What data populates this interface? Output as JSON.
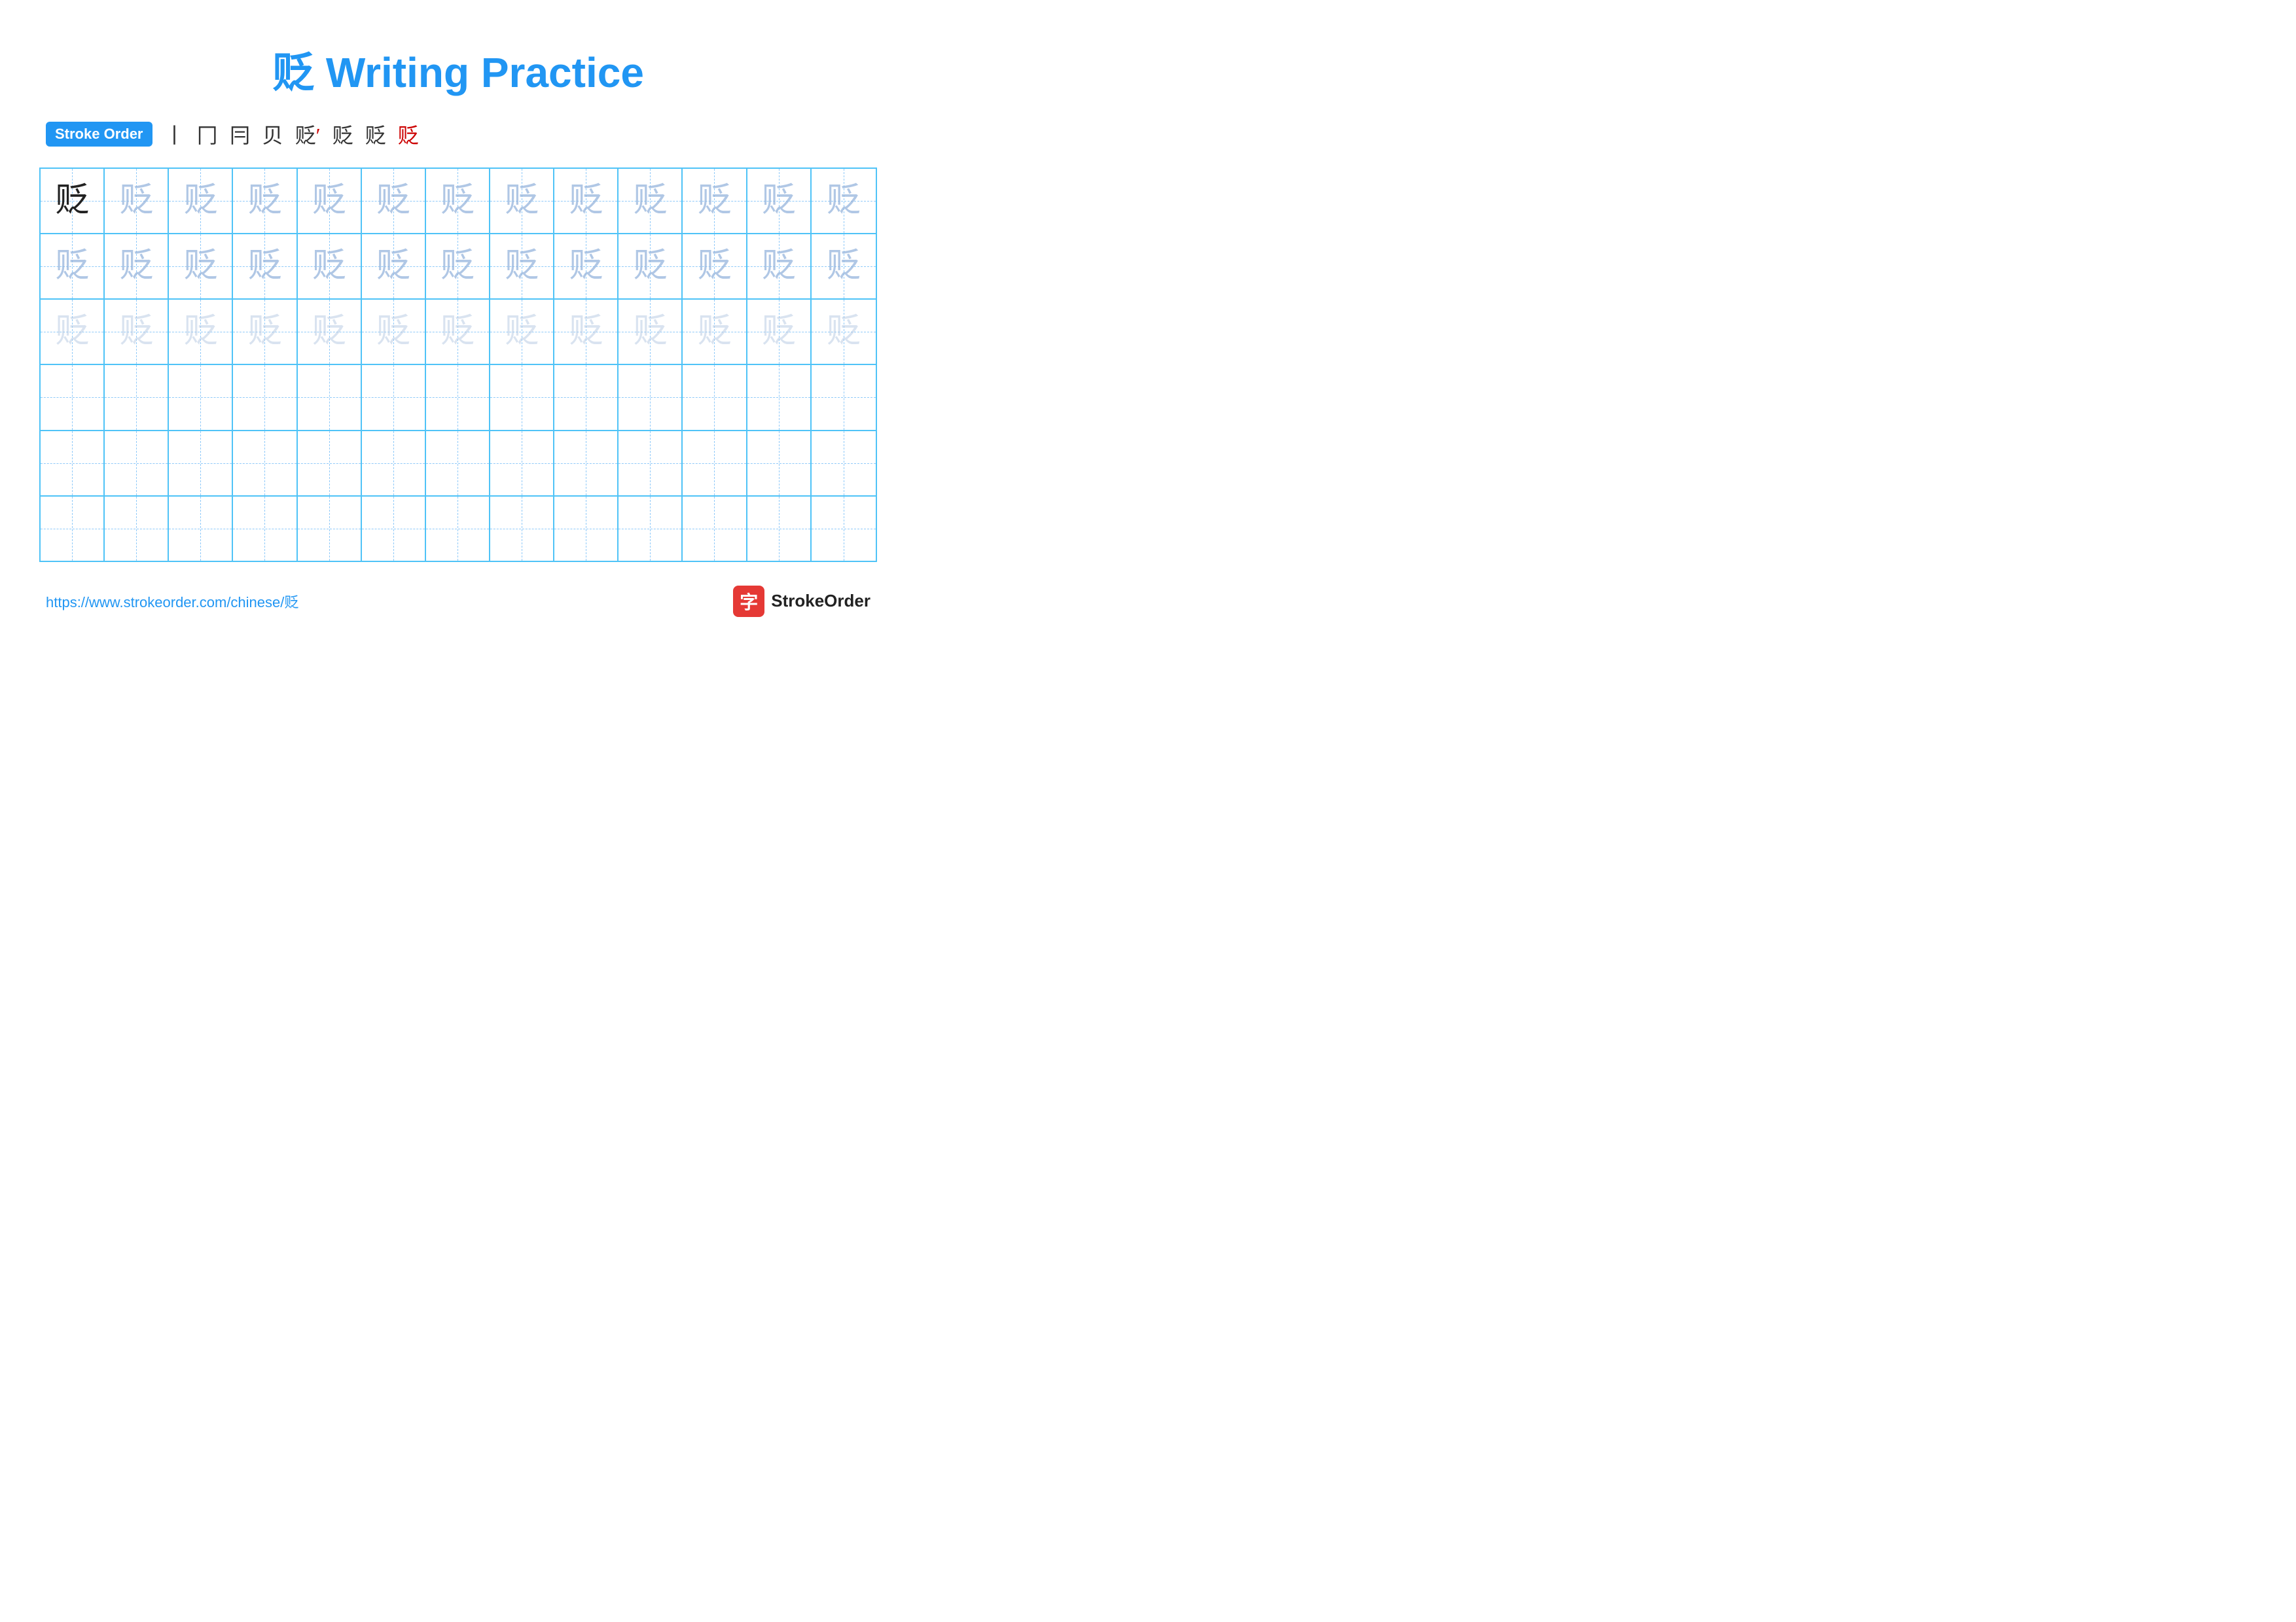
{
  "title": "贬 Writing Practice",
  "stroke_order": {
    "label": "Stroke Order",
    "steps": [
      "丨",
      "冂",
      "冂",
      "贝",
      "贬",
      "贬",
      "贬",
      "贬"
    ]
  },
  "character": "贬",
  "grid": {
    "rows": 6,
    "cols": 13
  },
  "footer": {
    "url": "https://www.strokeorder.com/chinese/贬",
    "brand": "StrokeOrder",
    "brand_char": "字"
  }
}
